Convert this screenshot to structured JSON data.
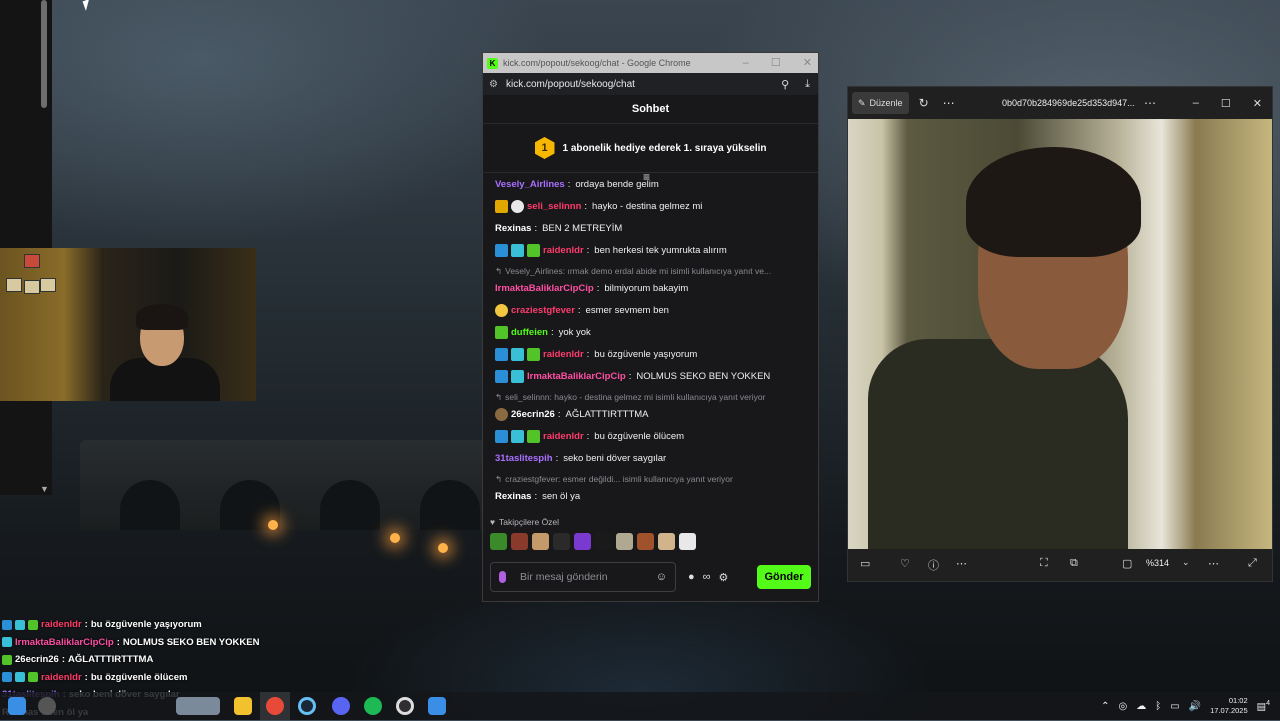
{
  "chrome": {
    "title": "kick.com/popout/sekoog/chat - Google Chrome",
    "url": "kick.com/popout/sekoog/chat",
    "logo": "K"
  },
  "chat": {
    "header": "Sohbet",
    "promo_rank": "1",
    "promo_text": "1 abonelik hediye ederek 1. sıraya yükselin",
    "followers_label": "Takipçilere Özel",
    "input_placeholder": "Bir mesaj gönderin",
    "send_label": "Gönder",
    "messages": [
      {
        "user": "Vesely_Airlines",
        "color": "#a970ff",
        "text": "ordaya bende gelim",
        "badges": []
      },
      {
        "user": "seli_selinnn",
        "color": "#ff3b6b",
        "text": "hayko - destina gelmez mi",
        "badges": [
          "gold",
          "white"
        ]
      },
      {
        "user": "Rexinas",
        "color": "#ffffff",
        "text": "BEN 2 METREYİM",
        "badges": []
      },
      {
        "user": "raidenldr",
        "color": "#ff3b6b",
        "text": "ben herkesi tek yumrukta alırım",
        "badges": [
          "blue",
          "cyan",
          "green"
        ]
      },
      {
        "reply": "Vesely_Airlines: ırmak demo erdal abide mi isimli kullanıcıya yanıt ve..."
      },
      {
        "user": "IrmaktaBaliklarCipCip",
        "color": "#ff4fa3",
        "text": "bilmiyorum bakayim",
        "badges": []
      },
      {
        "user": "craziestgfever",
        "color": "#ff3b6b",
        "text": "esmer sevmem ben",
        "badges": [
          "yellow"
        ]
      },
      {
        "user": "duffeien",
        "color": "#53fc18",
        "text": "yok yok",
        "badges": [
          "green"
        ]
      },
      {
        "user": "raidenldr",
        "color": "#ff3b6b",
        "text": "bu özgüvenle yaşıyorum",
        "badges": [
          "blue",
          "cyan",
          "green"
        ]
      },
      {
        "user": "IrmaktaBaliklarCipCip",
        "color": "#ff4fa3",
        "text": "NOLMUS SEKO BEN YOKKEN",
        "badges": [
          "blue",
          "cyan"
        ]
      },
      {
        "reply": "seli_selinnn: hayko - destina gelmez mi isimli kullanıcıya yanıt veriyor"
      },
      {
        "user": "26ecrin26",
        "color": "#ffffff",
        "text": "AĞLATTTIRTTTMA",
        "badges": [
          "brown"
        ]
      },
      {
        "user": "raidenldr",
        "color": "#ff3b6b",
        "text": "bu özgüvenle ölücem",
        "badges": [
          "blue",
          "cyan",
          "green"
        ]
      },
      {
        "user": "31taslitespih",
        "color": "#a970ff",
        "text": "seko beni döver saygılar",
        "badges": []
      },
      {
        "reply": "craziestgfever: esmer değildi... isimli kullanıcıya yanıt veriyor"
      },
      {
        "user": "Rexinas",
        "color": "#ffffff",
        "text": "sen öl ya",
        "badges": []
      }
    ]
  },
  "viewer": {
    "edit_label": "Düzenle",
    "filename": "0b0d70b284969de25d353d947...",
    "zoom": "%314"
  },
  "overlay": [
    {
      "user": "raidenldr",
      "color": "#ff3b6b",
      "text": "bu özgüvenle yaşıyorum",
      "badges": [
        "blue",
        "cyan",
        "green"
      ]
    },
    {
      "user": "IrmaktaBaliklarCipCip",
      "color": "#ff4fa3",
      "text": "NOLMUS SEKO BEN YOKKEN",
      "badges": [
        "cyan"
      ]
    },
    {
      "user": "26ecrin26",
      "color": "#ffffff",
      "text": "AĞLATTTIRTTTMA",
      "badges": [
        "green"
      ]
    },
    {
      "user": "raidenldr",
      "color": "#ff3b6b",
      "text": "bu özgüvenle ölücem",
      "badges": [
        "blue",
        "cyan",
        "green"
      ]
    },
    {
      "user": "31taslitespih",
      "color": "#a970ff",
      "text": "seko beni döver saygılar",
      "badges": []
    },
    {
      "user": "Rexinas",
      "color": "#ffffff",
      "text": "sen öl ya",
      "badges": []
    }
  ],
  "taskbar": {
    "time": "01:02",
    "date": "17.07.2025",
    "notifications": "4",
    "apps": [
      "start",
      "search",
      "thumbnail",
      "file-explorer",
      "chrome",
      "steam",
      "discord",
      "spotify",
      "obs",
      "kick"
    ]
  }
}
